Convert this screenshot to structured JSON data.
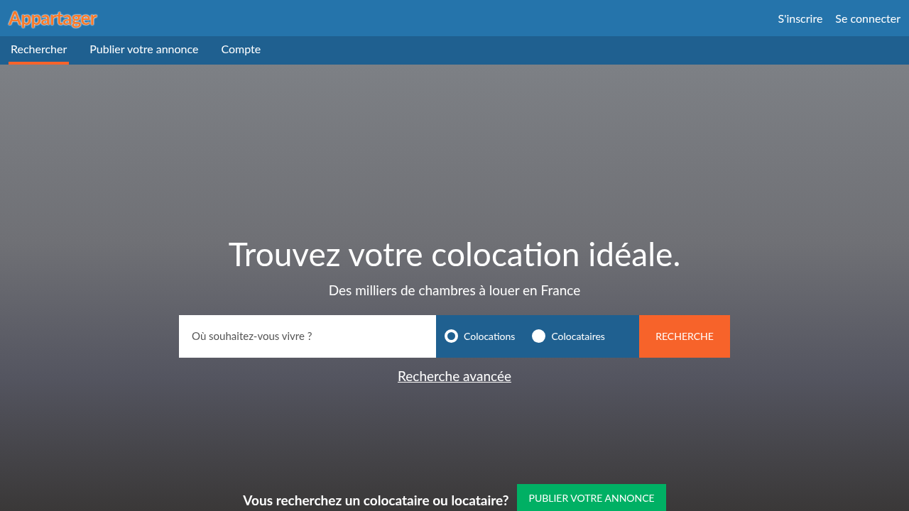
{
  "logo": "Appartager",
  "header_links": [
    "S'inscrire",
    "Se connecter"
  ],
  "tabs": [
    {
      "label": "Rechercher",
      "selected": true
    },
    {
      "label": "Publier votre annonce",
      "selected": false
    },
    {
      "label": "Compte",
      "selected": false
    }
  ],
  "hero": {
    "title": "Trouvez votre colocation idéale.",
    "subtitle": "Des milliers de chambres à louer en France"
  },
  "search": {
    "placeholder": "Où souhaitez-vous vivre ?",
    "button": "RECHERCHE"
  },
  "options": [
    {
      "label": "Colocations",
      "selected": true
    },
    {
      "label": "Colocataires",
      "selected": false
    }
  ],
  "advanced_link": "Recherche avancée",
  "cta": {
    "text": "Vous recherchez un colocataire ou locataire?",
    "button": "PUBLIER VOTRE ANNONCE"
  }
}
